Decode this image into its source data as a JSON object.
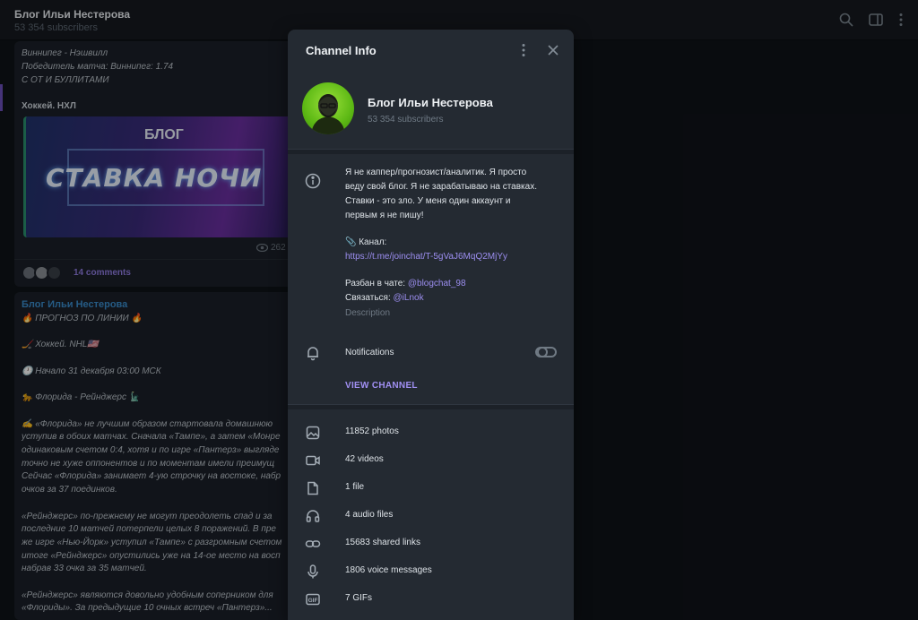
{
  "header": {
    "title": "Блог Ильи Нестерова",
    "subscribers": "53 354 subscribers"
  },
  "background_chat": {
    "msg1_lines": [
      "Виннипег - Нэшвилл",
      "Победитель матча: Виннипег: 1.74",
      "С ОТ И БУЛЛИТАМИ"
    ],
    "msg1_heading": "Хоккей. НХЛ",
    "banner_text": "СТАВКА НОЧИ",
    "banner_logo": "БЛОГ",
    "views": "262",
    "comments": "14 comments",
    "msg2_author": "Блог Ильи Нестерова",
    "msg2_lines": [
      "🔥 ПРОГНОЗ ПО ЛИНИИ 🔥",
      "",
      "🏒 Хоккей. NHL🇺🇸",
      "",
      "🕛 Начало 31 декабря 03:00 МСК",
      "",
      "🐆 Флорида - Рейнджерс 🗽",
      "",
      "✍️ «Флорида» не лучшим образом стартовала домашнюю",
      "уступив в обоих матчах. Сначала «Тампе», а затем «Монре",
      "одинаковым счетом 0:4, хотя и по игре «Пантерз» выгляде",
      "точно не хуже оппонентов и по моментам имели преимущ",
      "Сейчас «Флорида» занимает 4-ую строчку на востоке, набр",
      "очков за 37 поединков.",
      "",
      "«Рейнджерс» по-прежнему не могут преодолеть спад и за",
      "последние 10 матчей потерпели целых 8 поражений. В пре",
      "же игре «Нью-Йорк» уступил «Тампе» с разгромным счетом",
      "итоге «Рейнджерс» опустились уже на 14-ое место на восп",
      "набрав 33 очка за 35 матчей.",
      "",
      "«Рейнджерс» являются довольно удобным соперником для",
      "«Флориды». За предыдущие 10 очных встреч «Пантерз»..."
    ]
  },
  "panel": {
    "title": "Channel Info",
    "channel_name": "Блог Ильи Нестерова",
    "channel_subscribers": "53 354 subscribers",
    "description_lines": [
      "Я не каппер/прогнозист/аналитик. Я просто",
      "веду свой блог. Я не зарабатываю на ставках.",
      "Ставки - это зло. У меня один аккаунт и",
      "первым я не пишу!"
    ],
    "channel_label": "📎 Канал:",
    "channel_link": "https://t.me/joinchat/T-5gVaJ6MqQ2MjYy",
    "chat_label": "Разбан в чате: ",
    "chat_handle": "@blogchat_98",
    "contact_label": "Связаться: ",
    "contact_handle": "@iLnok",
    "description_caption": "Description",
    "notifications_label": "Notifications",
    "notifications_on": false,
    "view_channel": "VIEW CHANNEL",
    "media": [
      {
        "icon": "photo-icon",
        "label": "11852 photos"
      },
      {
        "icon": "video-icon",
        "label": "42 videos"
      },
      {
        "icon": "file-icon",
        "label": "1 file"
      },
      {
        "icon": "headphones-icon",
        "label": "4 audio files"
      },
      {
        "icon": "link-icon",
        "label": "15683 shared links"
      },
      {
        "icon": "microphone-icon",
        "label": "1806 voice messages"
      },
      {
        "icon": "gif-icon",
        "label": "7 GIFs"
      }
    ]
  },
  "colors": {
    "accent": "#9c8ef0",
    "panel_bg": "#242a32",
    "app_bg": "#0f1318"
  }
}
